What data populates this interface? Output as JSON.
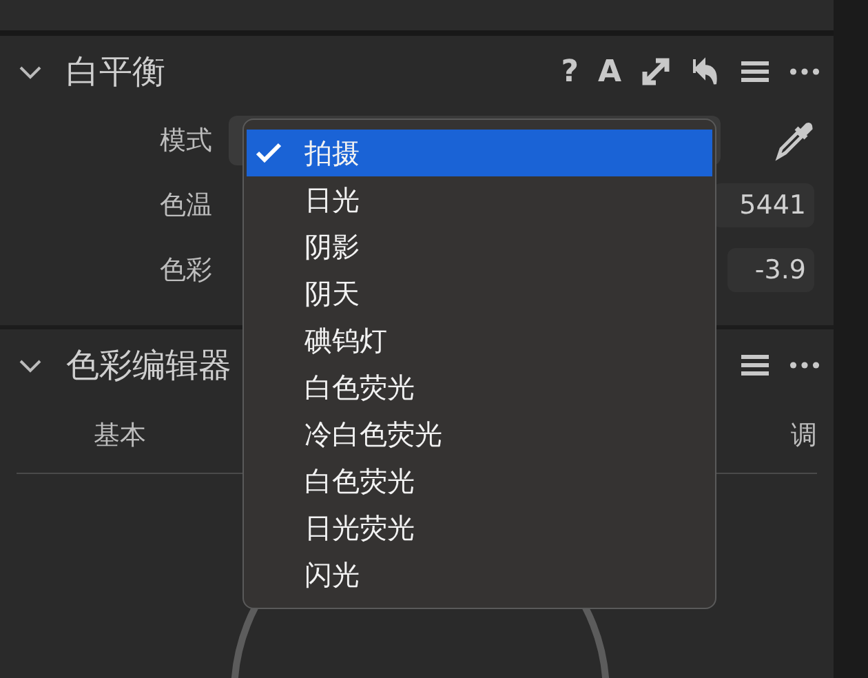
{
  "white_balance": {
    "title": "白平衡",
    "expanded": true,
    "help_button": "?",
    "auto_button": "A",
    "rows": [
      {
        "kind": "select",
        "label": "模式"
      },
      {
        "kind": "value",
        "label": "色温",
        "value": "5441"
      },
      {
        "kind": "value",
        "label": "色彩",
        "value": "-3.9"
      }
    ]
  },
  "color_editor": {
    "title": "色彩编辑器",
    "expanded": true,
    "tabs": [
      {
        "label": "基本",
        "selected": false
      },
      {
        "label": "调",
        "selected": false
      }
    ]
  },
  "mode_menu": {
    "items": [
      {
        "label": "拍摄",
        "selected": true
      },
      {
        "label": "日光",
        "selected": false
      },
      {
        "label": "阴影",
        "selected": false
      },
      {
        "label": "阴天",
        "selected": false
      },
      {
        "label": "碘钨灯",
        "selected": false
      },
      {
        "label": "白色荧光",
        "selected": false
      },
      {
        "label": "冷白色荧光",
        "selected": false
      },
      {
        "label": "白色荧光",
        "selected": false
      },
      {
        "label": "日光荧光",
        "selected": false
      },
      {
        "label": "闪光",
        "selected": false
      }
    ]
  }
}
